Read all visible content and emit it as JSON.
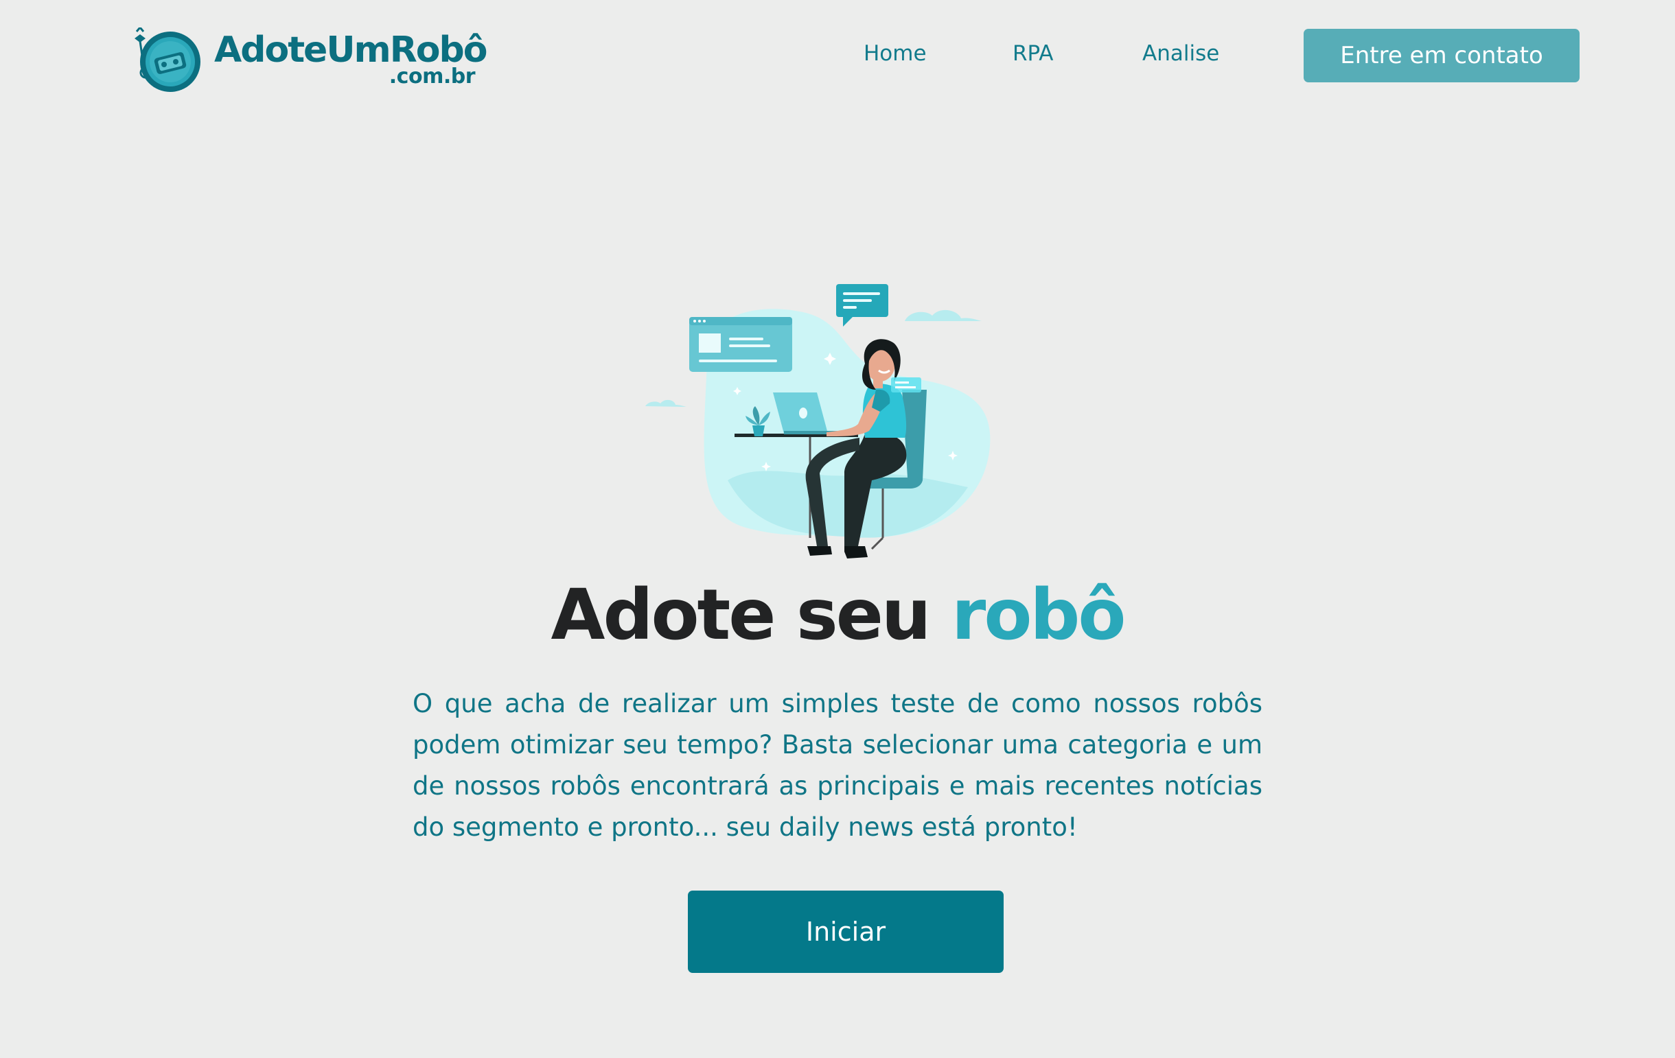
{
  "brand": {
    "name": "AdoteUmRobô",
    "domain": ".com.br",
    "primary_color": "#0c6f80",
    "accent_color": "#2aa8ba",
    "logo_icon": "robot-coin-icon"
  },
  "nav": {
    "items": [
      {
        "label": "Home"
      },
      {
        "label": "RPA"
      },
      {
        "label": "Analise"
      }
    ],
    "cta_label": "Entre em contato"
  },
  "hero": {
    "illustration": "woman-working-on-laptop-illustration",
    "title_part1": "Adote seu",
    "title_part2": "robô",
    "description": "O que acha de realizar um simples teste de como nossos robôs podem otimizar seu tempo? Basta selecionar uma categoria e um de nossos robôs encontrará as principais e mais recentes notícias do segmento e pronto... seu daily news está pronto!",
    "button_label": "Iniciar"
  }
}
